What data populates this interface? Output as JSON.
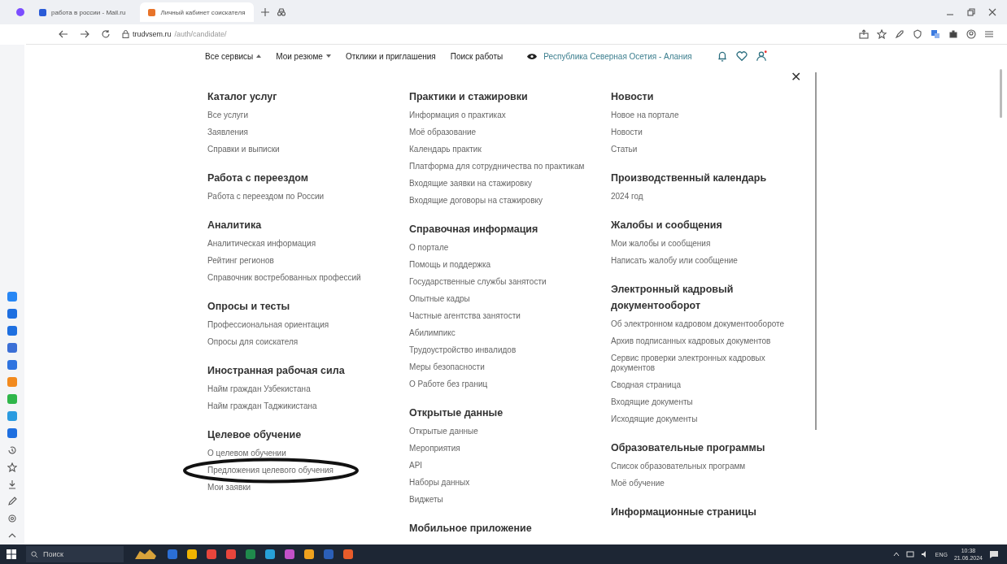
{
  "browser": {
    "tabs": [
      {
        "title": "работа в россии - Mail.ru",
        "selected": false
      },
      {
        "title": "Личный кабинет соискателя",
        "selected": true
      }
    ],
    "address": {
      "domain": "trudvsem.ru",
      "path": "/auth/candidate/"
    }
  },
  "nav": {
    "items": [
      {
        "label": "Все сервисы",
        "kind": "dropdown",
        "expanded": true
      },
      {
        "label": "Мои резюме",
        "kind": "dropdown",
        "expanded": false
      },
      {
        "label": "Отклики и приглашения",
        "kind": "link"
      },
      {
        "label": "Поиск работы",
        "kind": "link"
      }
    ],
    "region": "Республика Северная Осетия - Алания"
  },
  "menu": {
    "columns": [
      [
        {
          "title": "Каталог услуг",
          "items": [
            "Все услуги",
            "Заявления",
            "Справки и выписки"
          ]
        },
        {
          "title": "Работа с переездом",
          "items": [
            "Работа с переездом по России"
          ]
        },
        {
          "title": "Аналитика",
          "items": [
            "Аналитическая информация",
            "Рейтинг регионов",
            "Справочник востребованных профессий"
          ]
        },
        {
          "title": "Опросы и тесты",
          "items": [
            "Профессиональная ориентация",
            "Опросы для соискателя"
          ]
        },
        {
          "title": "Иностранная рабочая сила",
          "items": [
            "Найм граждан Узбекистана",
            "Найм граждан Таджикистана"
          ]
        },
        {
          "title": "Целевое обучение",
          "items": [
            "О целевом обучении",
            "Предложения целевого обучения",
            "Мои заявки"
          ]
        }
      ],
      [
        {
          "title": "Практики и стажировки",
          "items": [
            "Информация о практиках",
            "Моё образование",
            "Календарь практик",
            "Платформа для сотрудничества по практикам",
            "Входящие заявки на стажировку",
            "Входящие договоры на стажировку"
          ]
        },
        {
          "title": "Справочная информация",
          "items": [
            "О портале",
            "Помощь и поддержка",
            "Государственные службы занятости",
            "Опытные кадры",
            "Частные агентства занятости",
            "Абилимпикс",
            "Трудоустройство инвалидов",
            "Меры безопасности",
            "О Работе без границ"
          ]
        },
        {
          "title": "Открытые данные",
          "items": [
            "Открытые данные",
            "Мероприятия",
            "API",
            "Наборы данных",
            "Виджеты"
          ]
        },
        {
          "title": "Мобильное приложение"
        }
      ],
      [
        {
          "title": "Новости",
          "items": [
            "Новое на портале",
            "Новости",
            "Статьи"
          ]
        },
        {
          "title": "Производственный календарь",
          "items": [
            "2024 год"
          ]
        },
        {
          "title": "Жалобы и сообщения",
          "items": [
            "Мои жалобы и сообщения",
            "Написать жалобу или сообщение"
          ]
        },
        {
          "title": "Электронный кадровый документооборот",
          "items": [
            "Об электронном кадровом документообороте",
            "Архив подписанных кадровых документов",
            "Сервис проверки электронных кадровых документов",
            "Сводная страница",
            "Входящие документы",
            "Исходящие документы"
          ]
        },
        {
          "title": "Образовательные программы",
          "items": [
            "Список образовательных программ",
            "Моё обучение"
          ]
        },
        {
          "title": "Информационные страницы"
        }
      ]
    ],
    "close_symbol": "✕"
  },
  "taskbar": {
    "search_placeholder": "Поиск",
    "language": "ENG",
    "time": "10:38",
    "date": "21.06.2024"
  }
}
